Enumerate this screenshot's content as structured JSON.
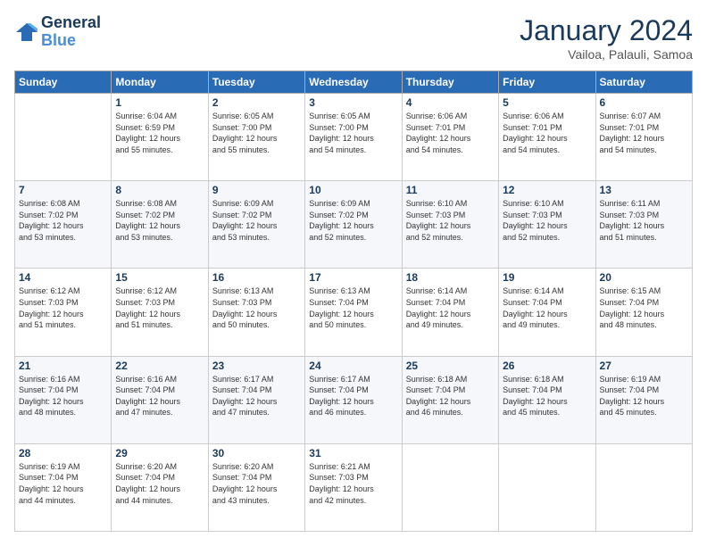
{
  "header": {
    "logo_line1": "General",
    "logo_line2": "Blue",
    "title": "January 2024",
    "subtitle": "Vailoa, Palauli, Samoa"
  },
  "weekdays": [
    "Sunday",
    "Monday",
    "Tuesday",
    "Wednesday",
    "Thursday",
    "Friday",
    "Saturday"
  ],
  "weeks": [
    [
      {
        "day": "",
        "info": ""
      },
      {
        "day": "1",
        "info": "Sunrise: 6:04 AM\nSunset: 6:59 PM\nDaylight: 12 hours\nand 55 minutes."
      },
      {
        "day": "2",
        "info": "Sunrise: 6:05 AM\nSunset: 7:00 PM\nDaylight: 12 hours\nand 55 minutes."
      },
      {
        "day": "3",
        "info": "Sunrise: 6:05 AM\nSunset: 7:00 PM\nDaylight: 12 hours\nand 54 minutes."
      },
      {
        "day": "4",
        "info": "Sunrise: 6:06 AM\nSunset: 7:01 PM\nDaylight: 12 hours\nand 54 minutes."
      },
      {
        "day": "5",
        "info": "Sunrise: 6:06 AM\nSunset: 7:01 PM\nDaylight: 12 hours\nand 54 minutes."
      },
      {
        "day": "6",
        "info": "Sunrise: 6:07 AM\nSunset: 7:01 PM\nDaylight: 12 hours\nand 54 minutes."
      }
    ],
    [
      {
        "day": "7",
        "info": "Sunrise: 6:08 AM\nSunset: 7:02 PM\nDaylight: 12 hours\nand 53 minutes."
      },
      {
        "day": "8",
        "info": "Sunrise: 6:08 AM\nSunset: 7:02 PM\nDaylight: 12 hours\nand 53 minutes."
      },
      {
        "day": "9",
        "info": "Sunrise: 6:09 AM\nSunset: 7:02 PM\nDaylight: 12 hours\nand 53 minutes."
      },
      {
        "day": "10",
        "info": "Sunrise: 6:09 AM\nSunset: 7:02 PM\nDaylight: 12 hours\nand 52 minutes."
      },
      {
        "day": "11",
        "info": "Sunrise: 6:10 AM\nSunset: 7:03 PM\nDaylight: 12 hours\nand 52 minutes."
      },
      {
        "day": "12",
        "info": "Sunrise: 6:10 AM\nSunset: 7:03 PM\nDaylight: 12 hours\nand 52 minutes."
      },
      {
        "day": "13",
        "info": "Sunrise: 6:11 AM\nSunset: 7:03 PM\nDaylight: 12 hours\nand 51 minutes."
      }
    ],
    [
      {
        "day": "14",
        "info": "Sunrise: 6:12 AM\nSunset: 7:03 PM\nDaylight: 12 hours\nand 51 minutes."
      },
      {
        "day": "15",
        "info": "Sunrise: 6:12 AM\nSunset: 7:03 PM\nDaylight: 12 hours\nand 51 minutes."
      },
      {
        "day": "16",
        "info": "Sunrise: 6:13 AM\nSunset: 7:03 PM\nDaylight: 12 hours\nand 50 minutes."
      },
      {
        "day": "17",
        "info": "Sunrise: 6:13 AM\nSunset: 7:04 PM\nDaylight: 12 hours\nand 50 minutes."
      },
      {
        "day": "18",
        "info": "Sunrise: 6:14 AM\nSunset: 7:04 PM\nDaylight: 12 hours\nand 49 minutes."
      },
      {
        "day": "19",
        "info": "Sunrise: 6:14 AM\nSunset: 7:04 PM\nDaylight: 12 hours\nand 49 minutes."
      },
      {
        "day": "20",
        "info": "Sunrise: 6:15 AM\nSunset: 7:04 PM\nDaylight: 12 hours\nand 48 minutes."
      }
    ],
    [
      {
        "day": "21",
        "info": "Sunrise: 6:16 AM\nSunset: 7:04 PM\nDaylight: 12 hours\nand 48 minutes."
      },
      {
        "day": "22",
        "info": "Sunrise: 6:16 AM\nSunset: 7:04 PM\nDaylight: 12 hours\nand 47 minutes."
      },
      {
        "day": "23",
        "info": "Sunrise: 6:17 AM\nSunset: 7:04 PM\nDaylight: 12 hours\nand 47 minutes."
      },
      {
        "day": "24",
        "info": "Sunrise: 6:17 AM\nSunset: 7:04 PM\nDaylight: 12 hours\nand 46 minutes."
      },
      {
        "day": "25",
        "info": "Sunrise: 6:18 AM\nSunset: 7:04 PM\nDaylight: 12 hours\nand 46 minutes."
      },
      {
        "day": "26",
        "info": "Sunrise: 6:18 AM\nSunset: 7:04 PM\nDaylight: 12 hours\nand 45 minutes."
      },
      {
        "day": "27",
        "info": "Sunrise: 6:19 AM\nSunset: 7:04 PM\nDaylight: 12 hours\nand 45 minutes."
      }
    ],
    [
      {
        "day": "28",
        "info": "Sunrise: 6:19 AM\nSunset: 7:04 PM\nDaylight: 12 hours\nand 44 minutes."
      },
      {
        "day": "29",
        "info": "Sunrise: 6:20 AM\nSunset: 7:04 PM\nDaylight: 12 hours\nand 44 minutes."
      },
      {
        "day": "30",
        "info": "Sunrise: 6:20 AM\nSunset: 7:04 PM\nDaylight: 12 hours\nand 43 minutes."
      },
      {
        "day": "31",
        "info": "Sunrise: 6:21 AM\nSunset: 7:03 PM\nDaylight: 12 hours\nand 42 minutes."
      },
      {
        "day": "",
        "info": ""
      },
      {
        "day": "",
        "info": ""
      },
      {
        "day": "",
        "info": ""
      }
    ]
  ]
}
